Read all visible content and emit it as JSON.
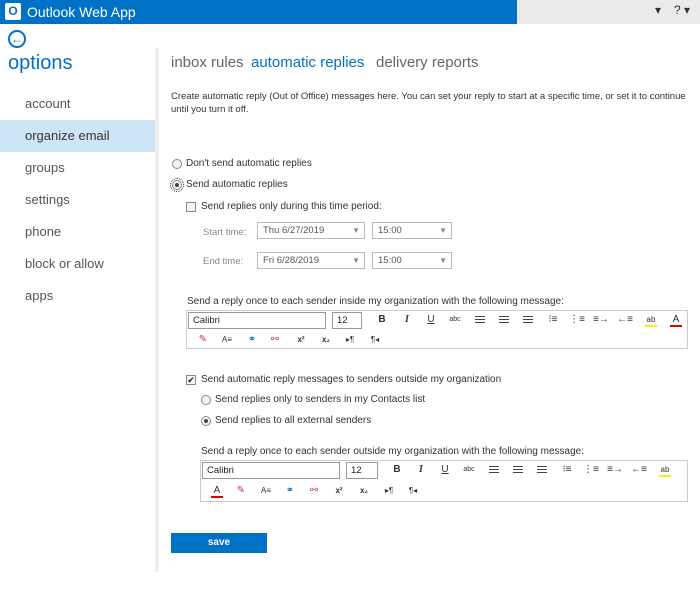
{
  "app": {
    "title": "Outlook Web App",
    "logo_letter": "O",
    "settings_glyph": "▾",
    "help_glyph": "? ▾"
  },
  "sidebar": {
    "title": "options",
    "items": [
      {
        "label": "account"
      },
      {
        "label": "organize email"
      },
      {
        "label": "groups"
      },
      {
        "label": "settings"
      },
      {
        "label": "phone"
      },
      {
        "label": "block or allow"
      },
      {
        "label": "apps"
      }
    ]
  },
  "tabs": [
    {
      "label": "inbox rules"
    },
    {
      "label": "automatic replies"
    },
    {
      "label": "delivery reports"
    }
  ],
  "intro": "Create automatic reply (Out of Office) messages here. You can set your reply to start at a specific time, or set it to continue until you turn it off.",
  "options": {
    "dont_send": "Don't send automatic replies",
    "send": "Send automatic replies",
    "time_period": "Send replies only during this time period:",
    "start_label": "Start time:",
    "start_date": "Thu 6/27/2019",
    "start_time": "15:00",
    "end_label": "End time:",
    "end_date": "Fri 6/28/2019",
    "end_time": "15:00"
  },
  "inside": {
    "label": "Send a reply once to each sender inside my organization with the following message:",
    "font": "Calibri",
    "size": "12"
  },
  "outside": {
    "checkbox": "Send automatic reply messages to senders outside my organization",
    "contacts_only": "Send replies only to senders in my Contacts list",
    "all_external": "Send replies to all external senders",
    "label": "Send a reply once to each sender outside my organization with the following message:",
    "font": "Calibri",
    "size": "12"
  },
  "toolbar_glyphs": {
    "bold": "B",
    "italic": "I",
    "underline": "U",
    "strike": "abc",
    "spell": "ab",
    "font_color": "A",
    "superscript": "x²",
    "subscript": "x₂",
    "ltr": "▸¶",
    "rtl": "¶◂",
    "link": "⛓",
    "unlink": "⛓",
    "eraser": "✎",
    "highlight_color": "#ffff00",
    "font_color_value": "#e00000"
  },
  "save_label": "save"
}
